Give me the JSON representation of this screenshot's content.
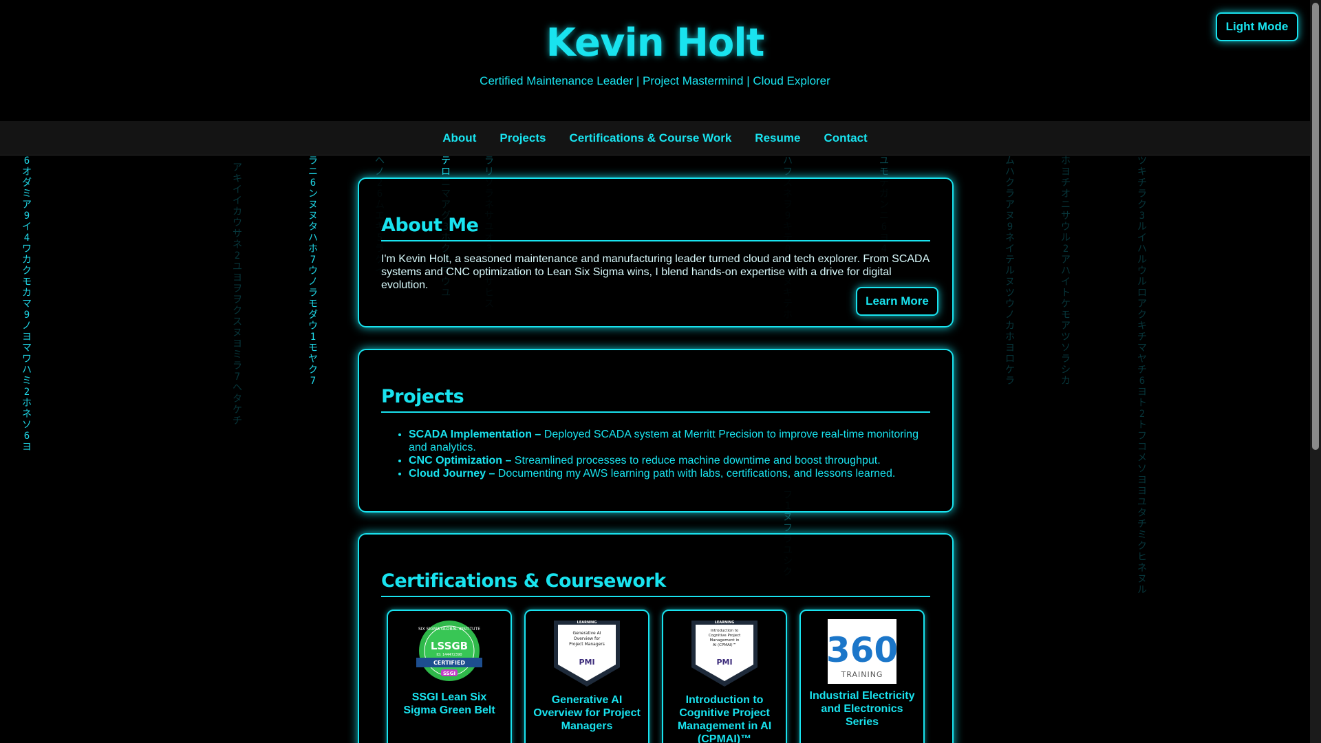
{
  "header": {
    "title": "Kevin Holt",
    "tagline": "Certified Maintenance Leader | Project Mastermind | Cloud Explorer",
    "theme_toggle": "Light Mode"
  },
  "nav": {
    "items": [
      "About",
      "Projects",
      "Certifications & Course Work",
      "Resume",
      "Contact"
    ]
  },
  "about": {
    "heading": "About Me",
    "text": "I'm Kevin Holt, a seasoned maintenance and manufacturing leader turned cloud and tech explorer. From SCADA systems and CNC optimization to Lean Six Sigma wins, I blend hands-on expertise with a drive for digital evolution.",
    "button": "Learn More"
  },
  "projects": {
    "heading": "Projects",
    "items": [
      {
        "title": "SCADA Implementation –",
        "desc": " Deployed SCADA system at Merritt Precision to improve real-time monitoring and analytics."
      },
      {
        "title": "CNC Optimization –",
        "desc": " Streamlined processes to reduce machine downtime and boost throughput."
      },
      {
        "title": "Cloud Journey –",
        "desc": " Documenting my AWS learning path with labs, certifications, and lessons learned."
      }
    ]
  },
  "certs": {
    "heading": "Certifications & Coursework",
    "items": [
      {
        "name": "SSGI Lean Six Sigma Green Belt",
        "badge_text": "LSSGB",
        "badge_sub": "CERTIFIED",
        "badge_id": "ID: 144472390",
        "badge_ring": "SIX SIGMA GLOBAL INSTITUTE",
        "badge_logo": "SSGI",
        "icon": "lssgb-badge-icon"
      },
      {
        "name": "Generative AI Overview for Project Managers",
        "badge_top": "LEARNING",
        "badge_text": "Generative AI Overview for Project Managers",
        "badge_logo": "PMI",
        "icon": "pmi-badge-icon"
      },
      {
        "name": "Introduction to Cognitive Project Management in AI (CPMAI)™",
        "badge_top": "LEARNING",
        "badge_text": "Introduction to Cognitive Project Management in AI (CPMAI)™",
        "badge_logo": "PMI",
        "icon": "pmi-badge-icon"
      },
      {
        "name": "Industrial Electricity and Electronics Series",
        "badge_text": "360",
        "badge_sub": "TRAINING",
        "icon": "360-training-logo-icon"
      }
    ]
  },
  "rain": {
    "columns": [
      {
        "text": "6オダミア9イ4ワカクモカマ9ノヨマワハミ2ホネソ6ヨ",
        "style": "bright"
      },
      {
        "text": "ラニ6ンヌヌタハホ7ウノラモダウ1モヤク7",
        "style": "bright"
      },
      {
        "text": "ヘノ26ムエキ5ラケイ",
        "style": "dim"
      },
      {
        "text": "テロニマアグ3ホクラマウユ",
        "style": "bright"
      },
      {
        "text": "ラリソラネサユオ3ウ1サヒス",
        "style": "dim"
      },
      {
        "text": "ユモテガンニ6ヨ4",
        "style": "dim"
      },
      {
        "text": "フ1ヌフラユシク",
        "style": "dim"
      }
    ]
  },
  "colors": {
    "accent": "#19e3ef",
    "background": "#000000",
    "nav_bg": "#141414"
  }
}
